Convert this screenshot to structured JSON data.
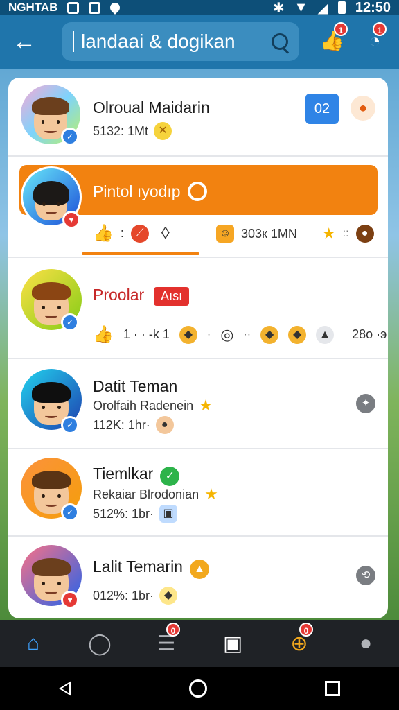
{
  "status_bar": {
    "left_text": "NGHTAB",
    "time": "12:50"
  },
  "header": {
    "back_icon": "arrow-left-icon",
    "search_text": "landaai & dogikan",
    "icons": [
      {
        "name": "like-icon",
        "badge": "1"
      },
      {
        "name": "notification-icon",
        "badge": "1"
      }
    ]
  },
  "top_item": {
    "name": "Olroual Maidarin",
    "meta": "5132: 1Mt",
    "count": "02",
    "emoji": "coin"
  },
  "highlighted": {
    "title": "Pintol ıyodıp",
    "reactions_left": ":",
    "reactions_right": "303к 1MN",
    "right_sep": "::"
  },
  "third_item": {
    "name": "Proolar",
    "tag": "Aısı",
    "counts": "1 · · -k 1",
    "tail": "28o ·э"
  },
  "list": [
    {
      "name": "Datit Teman",
      "sub": "Orolfaih Radenein",
      "meta": "112K: 1hr·",
      "badge": "blue",
      "side": "grey"
    },
    {
      "name": "Tiemlkar",
      "sub": "Rekaiar Blrodonian",
      "meta": "512%: 1br·",
      "badge": "blue",
      "side": "none"
    },
    {
      "name": "Lalit Temarin",
      "sub": "",
      "meta": "012%: 1br·",
      "badge": "red",
      "side": "grey"
    }
  ],
  "bottom_nav": [
    {
      "name": "home-icon",
      "badge": ""
    },
    {
      "name": "search-icon",
      "badge": ""
    },
    {
      "name": "burger-icon",
      "badge": "0"
    },
    {
      "name": "messages-icon",
      "badge": ""
    },
    {
      "name": "compass-icon",
      "badge": "0"
    },
    {
      "name": "profile-icon",
      "badge": ""
    }
  ],
  "colors": {
    "accent": "#f28210",
    "header": "#1f75ab",
    "verified": "#2f7fe0"
  }
}
